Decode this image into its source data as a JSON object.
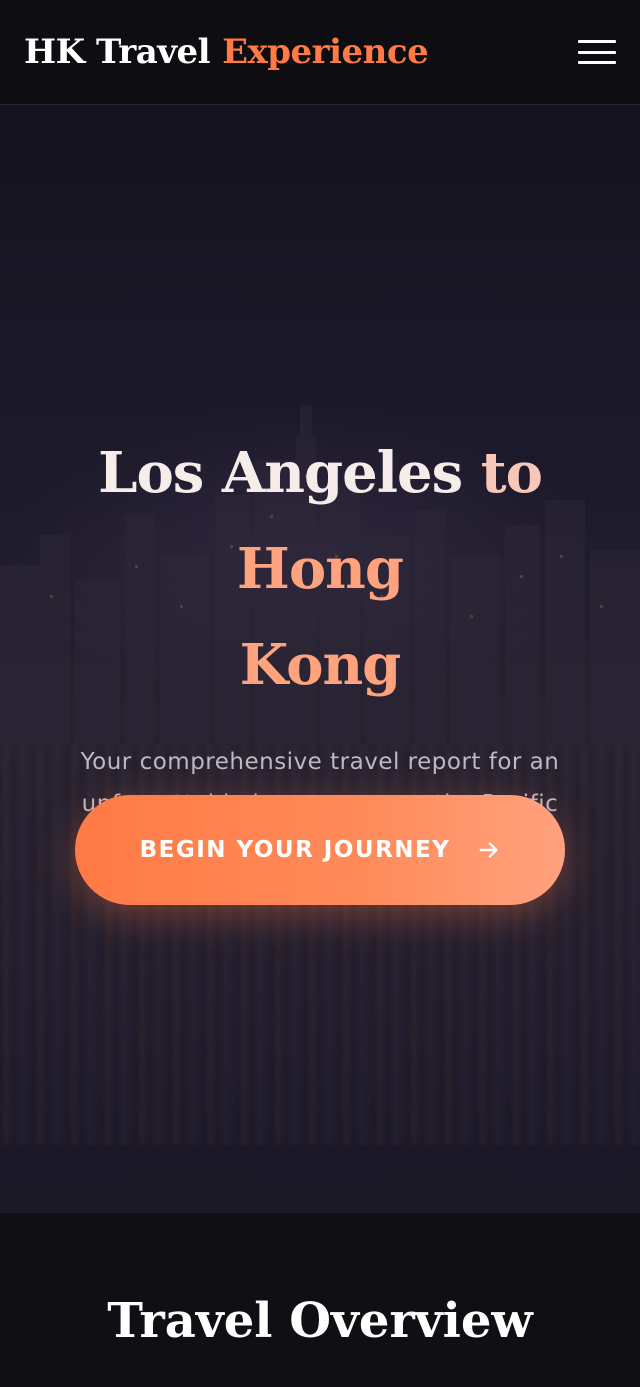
{
  "header": {
    "brand_main": "HK Travel",
    "brand_accent": "Experience",
    "menu_icon": "hamburger-menu-icon"
  },
  "hero": {
    "title_part1": "Los Angeles",
    "title_part2": "to",
    "title_part3": "Hong",
    "title_part4": "Kong",
    "subtitle": "Your comprehensive travel report for an unforgettable journey across the Pacific",
    "cta_label": "BEGIN YOUR JOURNEY",
    "cta_icon": "arrow-right-icon"
  },
  "overview": {
    "title": "Travel Overview"
  },
  "colors": {
    "accent": "#ff7a45",
    "accent_light": "#ffa27e",
    "background": "#0f0f14"
  }
}
